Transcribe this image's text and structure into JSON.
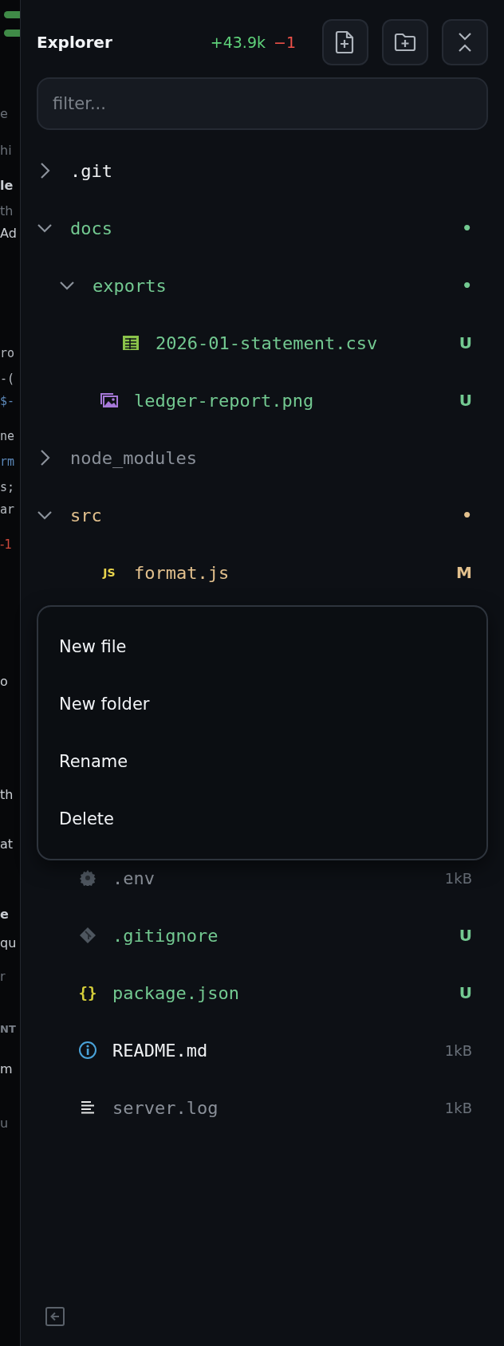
{
  "background_strip": [
    {
      "text": "e",
      "kind": "faint"
    },
    {
      "text": "hi",
      "kind": "faint"
    },
    {
      "text": "le",
      "kind": "bold"
    },
    {
      "text": "th",
      "kind": "faint"
    },
    {
      "text": "Ad",
      "kind": "plain"
    },
    {
      "text": "ro",
      "kind": "code"
    },
    {
      "text": "-(",
      "kind": "code"
    },
    {
      "text": "$-",
      "kind": "blue"
    },
    {
      "text": "ne",
      "kind": "code"
    },
    {
      "text": "rm",
      "kind": "blue"
    },
    {
      "text": "s;",
      "kind": "code"
    },
    {
      "text": "ar",
      "kind": "code"
    },
    {
      "text": "-1",
      "kind": "red"
    },
    {
      "text": "o",
      "kind": "plain"
    },
    {
      "text": "th",
      "kind": "plain"
    },
    {
      "text": "at",
      "kind": "plain"
    },
    {
      "text": "e",
      "kind": "bold"
    },
    {
      "text": "qu",
      "kind": "plain"
    },
    {
      "text": "r",
      "kind": "faint"
    },
    {
      "text": "NT",
      "kind": "caps"
    },
    {
      "text": "m",
      "kind": "plain"
    },
    {
      "text": "u",
      "kind": "faint"
    }
  ],
  "header": {
    "title": "Explorer",
    "added": "+43.9k",
    "removed": "−1"
  },
  "filter": {
    "placeholder": "filter..."
  },
  "tree": [
    {
      "name": ".git",
      "kind": "folder",
      "expanded": false,
      "color": "#eef0f2"
    },
    {
      "name": "docs",
      "kind": "folder",
      "expanded": true,
      "color": "#73c991",
      "badge": "•",
      "children": [
        {
          "name": "exports",
          "kind": "folder",
          "expanded": true,
          "color": "#73c991",
          "badge": "•",
          "children": [
            {
              "name": "2026-01-statement.csv",
              "kind": "spreadsheet",
              "color": "#73c991",
              "badge": "U"
            }
          ]
        },
        {
          "name": "ledger-report.png",
          "kind": "image",
          "color": "#73c991",
          "badge": "U"
        }
      ]
    },
    {
      "name": "node_modules",
      "kind": "folder",
      "expanded": false,
      "color": "#8a9099"
    },
    {
      "name": "src",
      "kind": "folder",
      "expanded": true,
      "color": "#e2c08d",
      "badge": "•",
      "children": [
        {
          "name": "format.js",
          "kind": "script",
          "icon_label": "JS",
          "color": "#e2c08d",
          "badge": "M",
          "menu_open": true
        }
      ]
    },
    {
      "name": ".env",
      "kind": "config",
      "color": "#8a9099",
      "size": "1kB"
    },
    {
      "name": ".gitignore",
      "kind": "gitignore",
      "color": "#73c991",
      "badge": "U"
    },
    {
      "name": "package.json",
      "kind": "json",
      "icon_label": "{}",
      "color": "#73c991",
      "badge": "U"
    },
    {
      "name": "README.md",
      "kind": "readme",
      "color": "#eef0f2",
      "size": "1kB"
    },
    {
      "name": "server.log",
      "kind": "log",
      "color": "#8a9099",
      "size": "1kB"
    }
  ],
  "context_menu": {
    "items": [
      "New file",
      "New folder",
      "Rename",
      "Delete"
    ]
  }
}
